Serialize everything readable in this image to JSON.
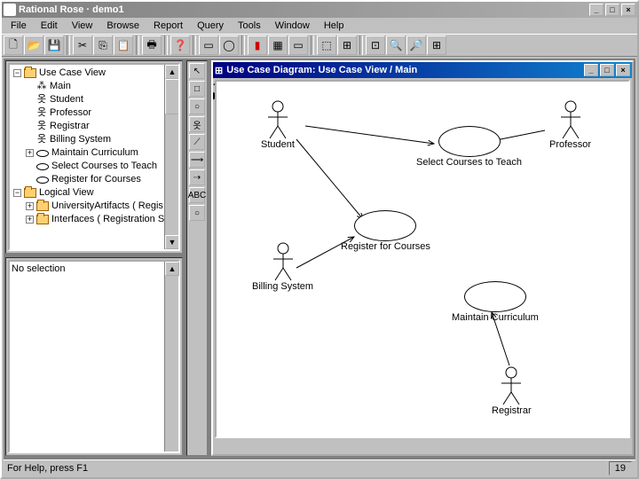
{
  "app": {
    "title": "Rational Rose · demo1"
  },
  "menu": [
    "File",
    "Edit",
    "View",
    "Browse",
    "Report",
    "Query",
    "Tools",
    "Window",
    "Help"
  ],
  "tree": {
    "root1": "Use Case View",
    "items1": [
      "Main",
      "Student",
      "Professor",
      "Registrar",
      "Billing System",
      "Maintain Curriculum",
      "Select Courses to Teach",
      "Register for Courses"
    ],
    "root2": "Logical View",
    "items2": [
      "UniversityArtifacts ( Regis",
      "Interfaces ( Registration S"
    ]
  },
  "props": {
    "text": "No selection"
  },
  "diagram": {
    "title": "Use Case Diagram: Use Case View / Main",
    "actors": {
      "student": "Student",
      "professor": "Professor",
      "billing": "Billing System",
      "registrar": "Registrar"
    },
    "usecases": {
      "select": "Select Courses to Teach",
      "register": "Register for Courses",
      "maintain": "Maintain Curriculum"
    }
  },
  "status": {
    "help": "For Help, press F1",
    "page": "19"
  },
  "toolbox_labels": [
    "↖",
    "□",
    "○",
    "옷",
    "⟋",
    "⟶",
    "⇢",
    "ABC",
    "○"
  ],
  "chart_data": {
    "type": "diagram",
    "diagram_type": "uml-use-case",
    "actors": [
      "Student",
      "Professor",
      "Billing System",
      "Registrar"
    ],
    "use_cases": [
      "Select Courses to Teach",
      "Register for Courses",
      "Maintain Curriculum"
    ],
    "associations": [
      {
        "from": "Student",
        "to": "Register for Courses"
      },
      {
        "from": "Student",
        "to": "Select Courses to Teach"
      },
      {
        "from": "Professor",
        "to": "Select Courses to Teach"
      },
      {
        "from": "Billing System",
        "to": "Register for Courses"
      },
      {
        "from": "Registrar",
        "to": "Maintain Curriculum"
      }
    ]
  }
}
